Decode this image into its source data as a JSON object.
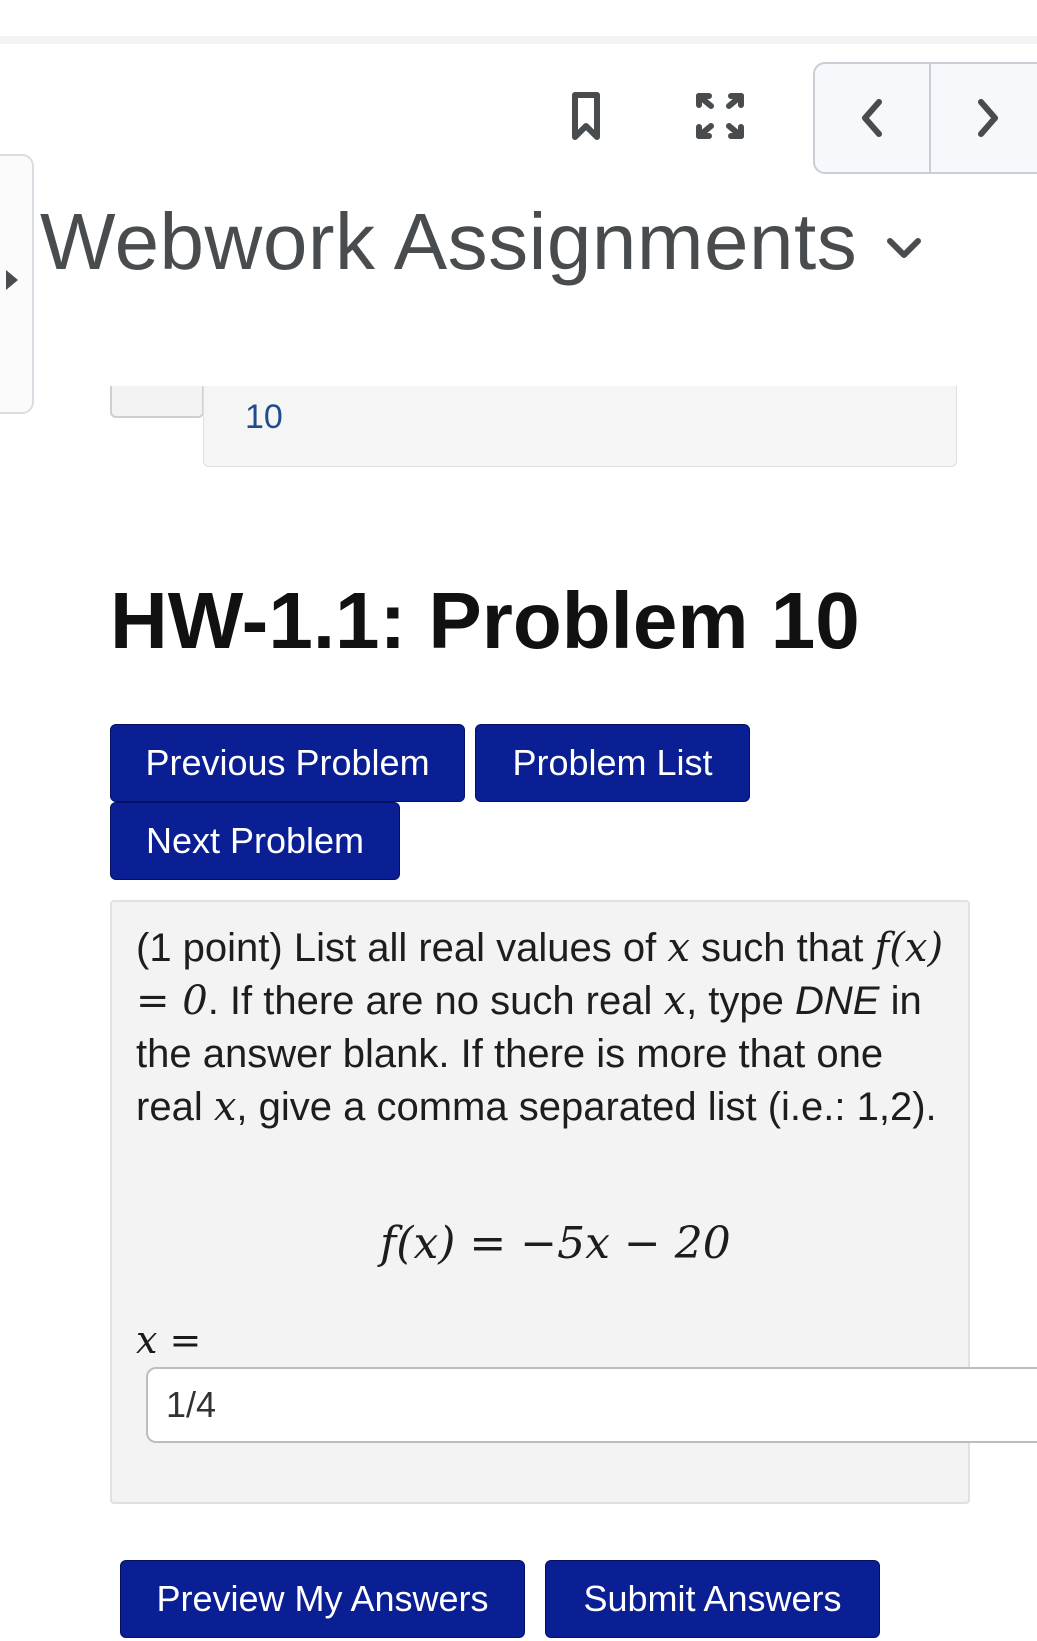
{
  "header": {
    "course_title": "Webwork Assignments",
    "bookmark_icon": "bookmark-icon",
    "fullscreen_icon": "fullscreen-icon",
    "prev_icon": "chevron-left-icon",
    "next_icon": "chevron-right-icon",
    "title_menu_icon": "chevron-down-icon"
  },
  "breadcrumb": {
    "visible_text": "10"
  },
  "problem": {
    "title": "HW-1.1: Problem 10",
    "buttons": {
      "previous": "Previous Problem",
      "list": "Problem List",
      "next": "Next Problem"
    },
    "text": {
      "part1": "(1 point) List all real values of ",
      "x": "x",
      "part2": " such that ",
      "fx_eq_0": "f(x) = 0",
      "part3": ". If there are no such real ",
      "part4": ", type ",
      "dne": "DNE",
      "part5": " in the answer blank. If there is more that one real ",
      "part6": ", give a comma separated list (i.e.: 1,2)."
    },
    "equation": "f(x) = −5x − 20",
    "answer_label": "x =",
    "answer_value": "1/4"
  },
  "actions": {
    "preview": "Preview My Answers",
    "submit": "Submit Answers"
  },
  "colors": {
    "primary_button": "#0b1f94",
    "panel_bg": "#f3f3f3",
    "link_text": "#1f4c8f"
  }
}
